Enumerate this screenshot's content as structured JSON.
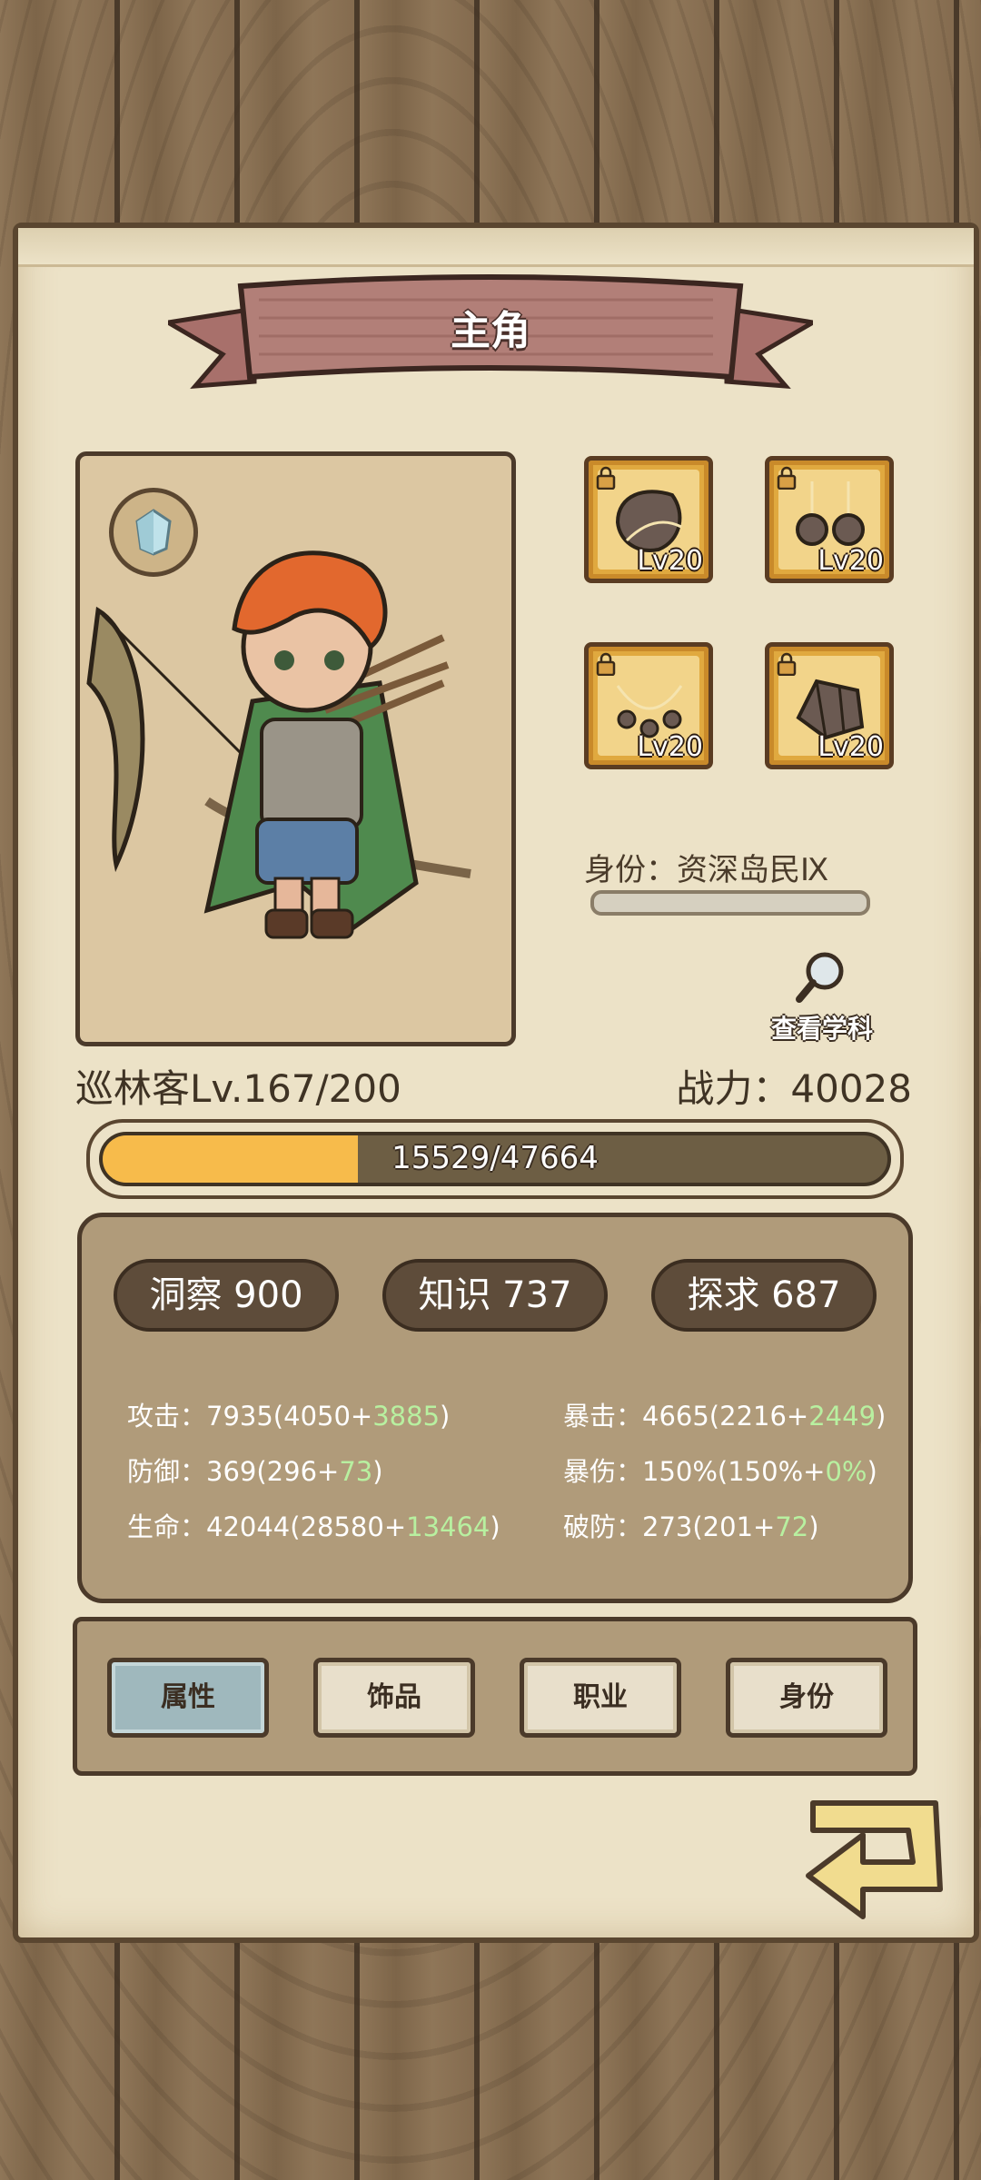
{
  "title": "主角",
  "equipment": [
    {
      "level": "Lv20",
      "icon": "stone-claw-icon",
      "locked": true
    },
    {
      "level": "Lv20",
      "icon": "stone-earrings-icon",
      "locked": true
    },
    {
      "level": "Lv20",
      "icon": "stone-necklace-icon",
      "locked": true
    },
    {
      "level": "Lv20",
      "icon": "stone-bracer-icon",
      "locked": true
    }
  ],
  "identity": {
    "label": "身份：资深岛民Ⅸ",
    "progress": 0.0
  },
  "view_subject": "查看学科",
  "class_level": "巡林客Lv.167/200",
  "power": "战力：40028",
  "xp": {
    "text": "15529/47664",
    "current": 15529,
    "max": 47664
  },
  "pills": [
    {
      "label": "洞察 900"
    },
    {
      "label": "知识 737"
    },
    {
      "label": "探求 687"
    }
  ],
  "stats_left": [
    {
      "prefix": "攻击：7935(4050+",
      "bonus": "3885",
      "suffix": ")"
    },
    {
      "prefix": "防御：369(296+",
      "bonus": "73",
      "suffix": ")"
    },
    {
      "prefix": "生命：42044(28580+",
      "bonus": "13464",
      "suffix": ")"
    }
  ],
  "stats_right": [
    {
      "prefix": "暴击：4665(2216+",
      "bonus": "2449",
      "suffix": ")"
    },
    {
      "prefix": "暴伤：150%(150%+",
      "bonus": "0%",
      "suffix": ")"
    },
    {
      "prefix": "破防：273(201+",
      "bonus": "72",
      "suffix": ")"
    }
  ],
  "tabs": [
    {
      "label": "属性",
      "active": true
    },
    {
      "label": "饰品",
      "active": false
    },
    {
      "label": "职业",
      "active": false
    },
    {
      "label": "身份",
      "active": false
    }
  ],
  "colors": {
    "xp_fill": "#f7bb4b",
    "bonus_green": "#b8f0a0",
    "active_tab": "#9fb8bd",
    "banner": "#b27f78"
  }
}
